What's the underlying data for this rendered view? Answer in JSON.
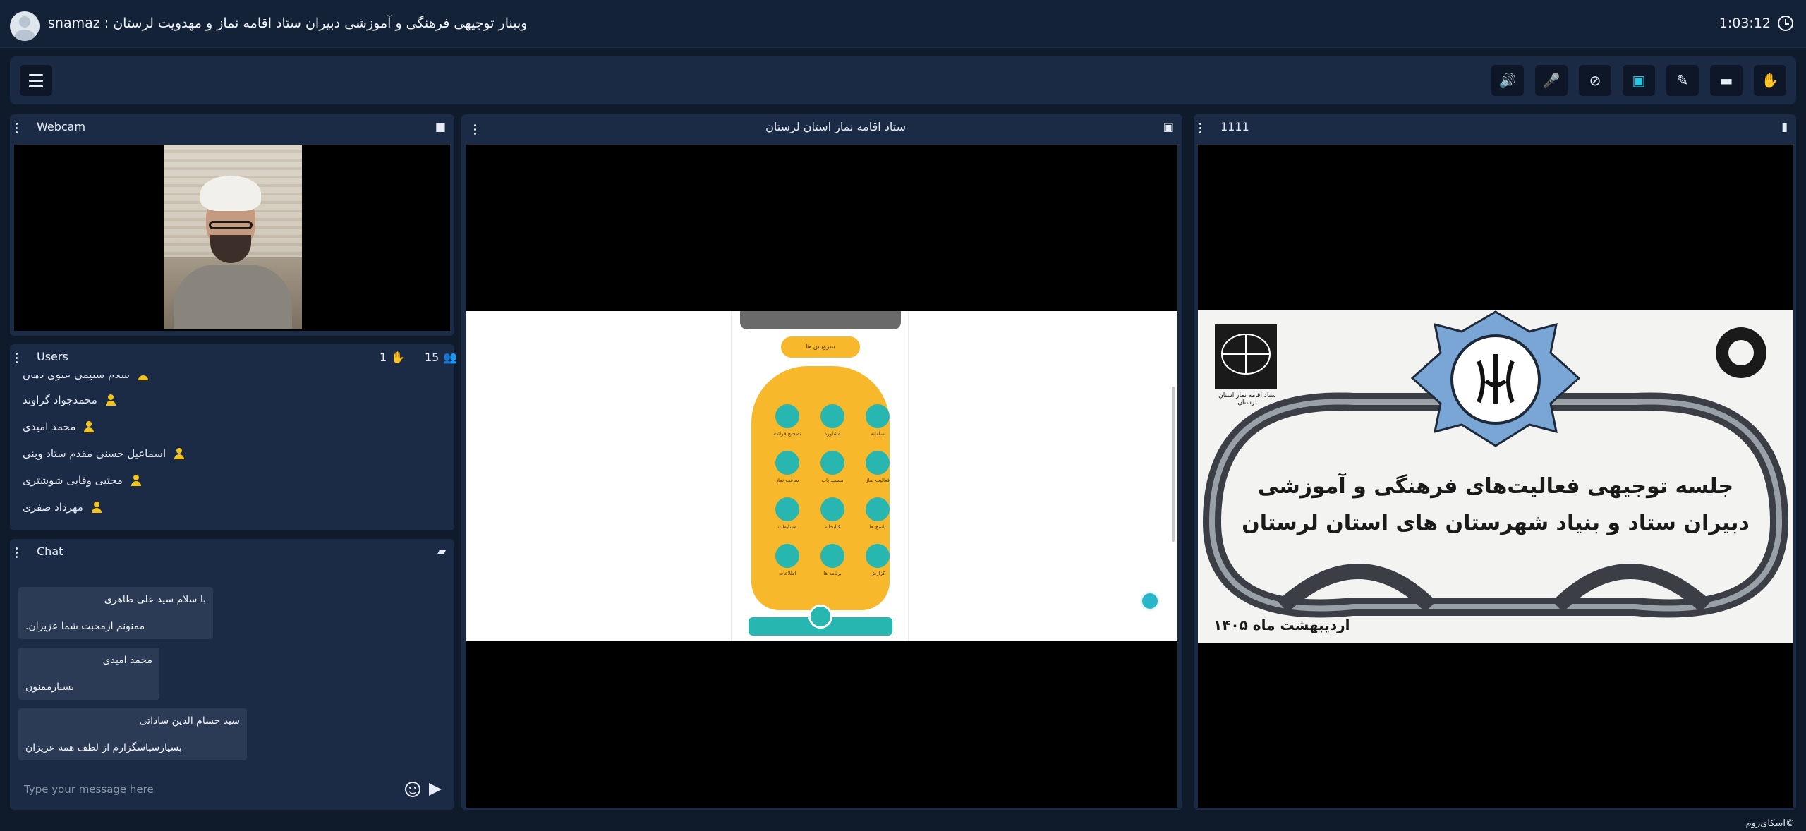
{
  "window": {
    "title": "وبینار توجیهی فرهنگی و آموزشی دبیران ستاد اقامه نماز و مهدویت لرستان : snamaz",
    "timer": "1:03:12"
  },
  "toolbar": {
    "buttons": [
      {
        "name": "speaker",
        "icon": "speaker-icon",
        "glyph": "🔊",
        "active": true
      },
      {
        "name": "microphone",
        "icon": "microphone-icon",
        "glyph": "🎤",
        "active": true
      },
      {
        "name": "camera-off",
        "icon": "camera-off-icon",
        "glyph": "⊘",
        "active": false
      },
      {
        "name": "screen-share",
        "icon": "screen-share-icon",
        "glyph": "▣",
        "active": true
      },
      {
        "name": "pen",
        "icon": "pen-icon",
        "glyph": "✎",
        "active": false
      },
      {
        "name": "folder",
        "icon": "folder-icon",
        "glyph": "▬",
        "active": false
      },
      {
        "name": "raise-hand",
        "icon": "hand-icon",
        "glyph": "✋",
        "active": false
      }
    ]
  },
  "webcam": {
    "title": "Webcam"
  },
  "users": {
    "title": "Users",
    "hand_count": "1",
    "user_count": "15",
    "items": [
      {
        "name": "سلام سلیمی علوی دهان"
      },
      {
        "name": "محمدجواد گراوند"
      },
      {
        "name": "محمد امیدی"
      },
      {
        "name": "اسماعیل حسنی مقدم ستاد وبنی"
      },
      {
        "name": "مجتبی وفایی شوشتری"
      },
      {
        "name": "مهرداد صفری"
      }
    ]
  },
  "chat": {
    "title": "Chat",
    "placeholder": "Type your message here",
    "messages": [
      {
        "sender": "با سلام سید علی طاهری",
        "text": "ممنونم ازمحبت شما عزیزان."
      },
      {
        "sender": "محمد امیدی",
        "text": "بسیارممنون"
      },
      {
        "sender": "سید حسام الدین ساداتی",
        "text": "بسیارسپاسگزارم از لطف همه عزیزان"
      }
    ]
  },
  "screen_share": {
    "title": "ستاد اقامه نماز استان لرستان",
    "app": {
      "header_pill": "سرویس ها",
      "grid": [
        "سامانه",
        "مشاوره",
        "تصحیح قرائت",
        "فعالیت نماز",
        "مسجد یاب",
        "ساعت نماز",
        "پاسخ ها",
        "کتابخانه",
        "مسابقات",
        "گزارش",
        "برنامه ها",
        "اطلاعات"
      ]
    }
  },
  "presentation": {
    "title": "1111",
    "banner_line1": "جلسه توجیهی فعالیت‌های فرهنگی و آموزشی",
    "banner_line2": "دبیران ستاد و بنیاد شهرستان های استان لرستان",
    "banner_date": "اردیبهشت ماه ۱۴۰۵",
    "logo_left_caption": "ستاد اقامه نماز استان لرستان"
  },
  "footer": {
    "brand": "©اسکای‌روم"
  }
}
